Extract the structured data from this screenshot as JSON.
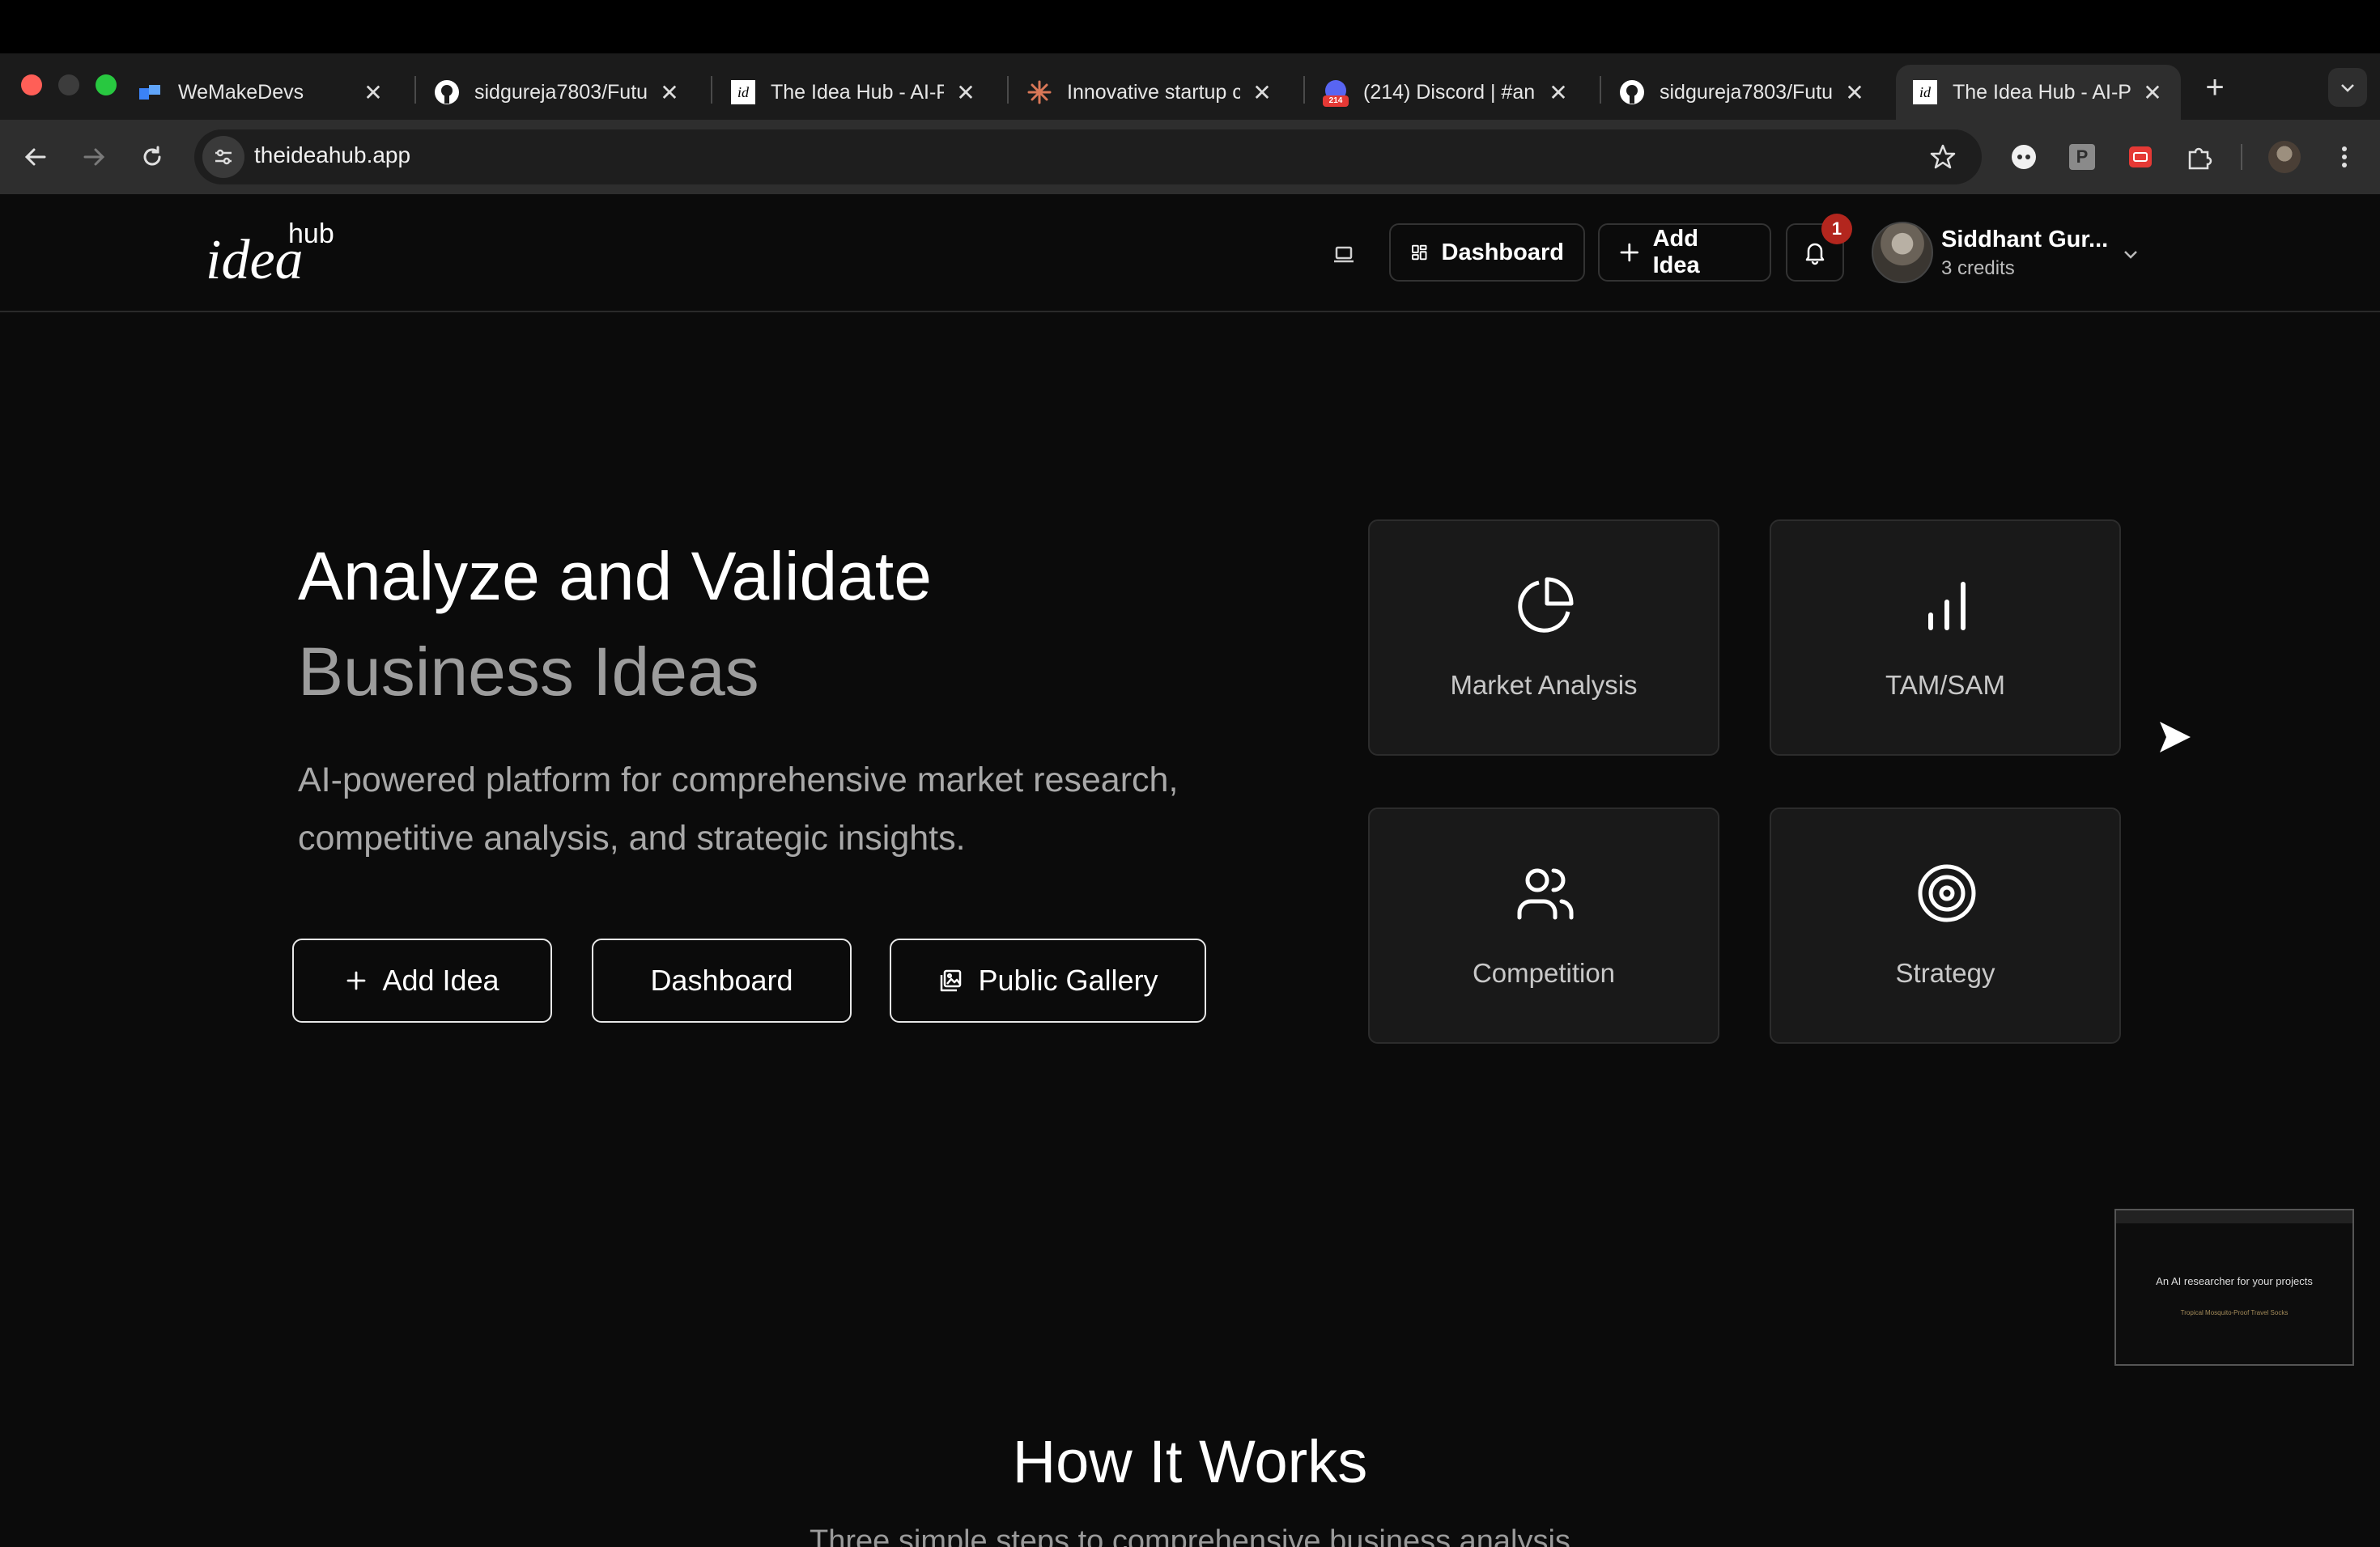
{
  "browser": {
    "tabs": [
      {
        "title": "WeMakeDevs",
        "icon": "wemakedevs-icon"
      },
      {
        "title": "sidgureja7803/Futu",
        "icon": "github-icon"
      },
      {
        "title": "The Idea Hub - AI-P",
        "icon": "ideahub-icon"
      },
      {
        "title": "Innovative startup c",
        "icon": "claude-icon"
      },
      {
        "title": "(214) Discord | #an",
        "icon": "discord-icon"
      },
      {
        "title": "sidgureja7803/Futu",
        "icon": "github-icon"
      },
      {
        "title": "The Idea Hub - AI-P",
        "icon": "ideahub-icon"
      }
    ],
    "active_tab": 6,
    "close_glyph": "✕",
    "new_tab_glyph": "+",
    "url": "theideahub.app",
    "ideahub_favicon_text": "id",
    "discord_badge": "214",
    "extension_p_label": "P"
  },
  "header": {
    "logo_main": "idea",
    "logo_sup": "hub",
    "dashboard_label": "Dashboard",
    "add_idea_label": "Add Idea",
    "notification_count": "1",
    "user_name": "Siddhant Gur...",
    "user_credits": "3 credits"
  },
  "hero": {
    "title_line1": "Analyze and Validate",
    "title_line2": "Business Ideas",
    "subtitle": "AI-powered platform for comprehensive market research, competitive analysis, and strategic insights.",
    "buttons": {
      "add_idea": "Add Idea",
      "dashboard": "Dashboard",
      "public_gallery": "Public Gallery"
    }
  },
  "features": [
    {
      "label": "Market Analysis",
      "icon": "pie-chart-icon"
    },
    {
      "label": "TAM/SAM",
      "icon": "bar-chart-icon"
    },
    {
      "label": "Competition",
      "icon": "users-icon"
    },
    {
      "label": "Strategy",
      "icon": "target-icon"
    }
  ],
  "preview": {
    "headline": "An AI researcher for your projects",
    "caption": "Tropical Mosquito-Proof Travel Socks"
  },
  "how_it_works": {
    "title": "How It Works",
    "subtitle": "Three simple steps to comprehensive business analysis"
  },
  "colors": {
    "background": "#0b0b0b",
    "card": "#191919",
    "badge": "#b3261e",
    "muted_text": "#9c9c9c"
  }
}
